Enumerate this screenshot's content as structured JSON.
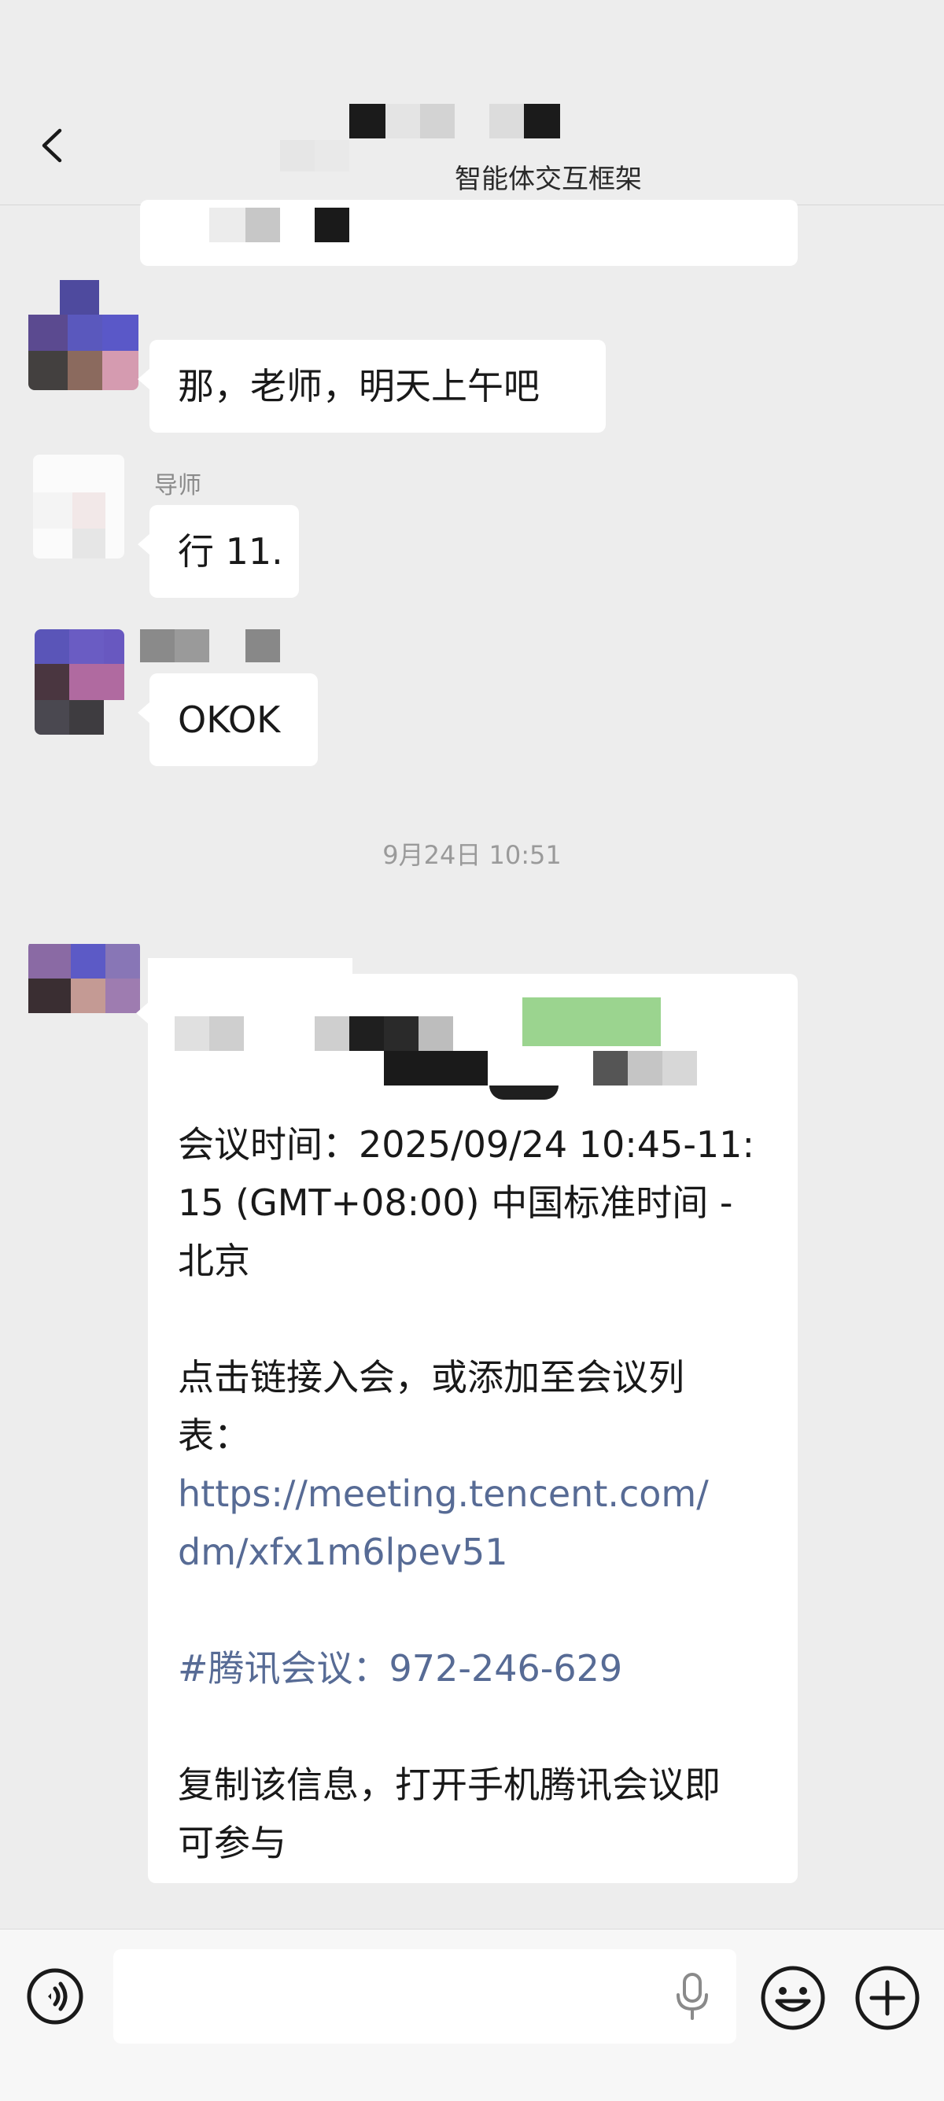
{
  "header": {
    "title": "",
    "subtitle": "智能体交互框架"
  },
  "messages": [
    {
      "sender": "",
      "text": "那，老师，明天上午吧"
    },
    {
      "sender": "导师",
      "text": "行 11."
    },
    {
      "sender": "",
      "text": "OKOK"
    }
  ],
  "timestamp": "9月24日 10:51",
  "meeting": {
    "time_line_1": "会议时间：2025/09/24 10:45-11:",
    "time_line_2": "15 (GMT+08:00) 中国标准时间 -",
    "time_line_3": "北京",
    "join_line_1": "点击链接入会，或添加至会议列",
    "join_line_2": "表：",
    "link_line_1": "https://meeting.tencent.com/",
    "link_line_2": "dm/xfx1m6lpev51",
    "meeting_id": "#腾讯会议：972-246-629",
    "copy_line_1": "复制该信息，打开手机腾讯会议即",
    "copy_line_2": "可参与"
  },
  "colors": {
    "background": "#ededed",
    "bubble": "#ffffff",
    "link": "#576b95",
    "timestamp": "#9a9a9a"
  },
  "icons": [
    "back-icon",
    "voice-icon",
    "microphone-icon",
    "emoji-icon",
    "plus-icon"
  ]
}
